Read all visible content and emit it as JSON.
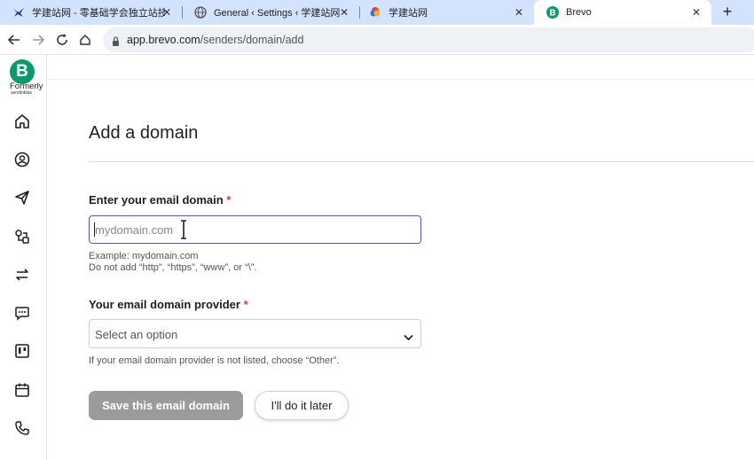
{
  "browser": {
    "tabs": [
      {
        "title": "学建站网 - 零基础学会独立站技术",
        "icon": "scissor-bird-favicon"
      },
      {
        "title": "General ‹ Settings ‹ 学建站网 — W",
        "icon": "globe-favicon"
      },
      {
        "title": "学建站网",
        "icon": "colorful-favicon"
      },
      {
        "title": "Brevo",
        "icon": "brevo-favicon"
      }
    ],
    "active_tab": 3,
    "new_tab_label": "+",
    "url_host": "app.brevo.com",
    "url_path": "/senders/domain/add"
  },
  "sidebar": {
    "logo_letter": "B",
    "formerly": "Formerly",
    "formerly_brand": "sendinblue",
    "brand_color": "#0b996e",
    "items": [
      "home-icon",
      "contacts-icon",
      "campaigns-icon",
      "automations-icon",
      "transactional-icon",
      "conversations-icon",
      "sales-icon",
      "meetings-icon",
      "phone-icon"
    ]
  },
  "page": {
    "title": "Add a domain",
    "domain_field": {
      "label": "Enter your email domain",
      "required_mark": "*",
      "placeholder": "mydomain.com",
      "value": "",
      "hint_line1": "Example: mydomain.com",
      "hint_line2": "Do not add “http”, “https”, “www”, or “\\”."
    },
    "provider_field": {
      "label": "Your email domain provider",
      "required_mark": "*",
      "selected": "Select an option",
      "hint": "If your email domain provider is not listed, choose “Other”."
    },
    "save_button": "Save this email domain",
    "later_button": "I'll do it later"
  }
}
